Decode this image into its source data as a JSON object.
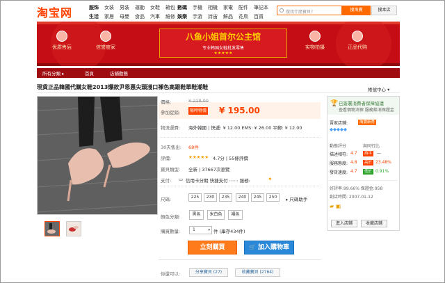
{
  "topbar": {
    "logo": "淘宝网",
    "nav1_row1": [
      "服饰",
      "女装",
      "男装",
      "運動",
      "女鞋",
      "箱包"
    ],
    "nav1_row2": [
      "生活",
      "家居",
      "母嬰",
      "食品",
      "汽車",
      "維修"
    ],
    "nav2_row1": [
      "數碼",
      "手機",
      "相機",
      "家電",
      "配件",
      "筆記本"
    ],
    "nav2_row2": [
      "娛樂",
      "手游",
      "詩宙",
      "鮮品",
      "花鳥",
      "百貨"
    ],
    "search_placeholder": "搜找什麼寶貝?",
    "search_button": "搜淘寶",
    "shop_button": "搜本店"
  },
  "banner": {
    "title": "八鱼小姐首尔公主馆",
    "subtitle": "专业韩国女鞋批发零售",
    "stars": "★★★★★",
    "left_icons": [
      "优质售后",
      "信誉度家"
    ],
    "right_icons": [
      "实物拍摄",
      "正品代购"
    ]
  },
  "shopnav": {
    "all_categories": "所有分類 ▸",
    "home": "首頁",
    "shop_dynamics": "店鋪動態"
  },
  "product": {
    "title": "現貨正品韓國代購女鞋2013爆款尹恩惠尖頭淺口裸色高跟鞋單鞋潮鞋",
    "fav_link": "帳號中心 ▾",
    "price_label": "價格:",
    "orig_price": "¥ 218.00",
    "promo_label": "參加促銷:",
    "promo_badge": "限時特價",
    "promo_price": "¥ 195.00",
    "shipping_label": "物流運費:",
    "shipping_value": "海外韓國 | 快遞: ¥ 12.00  EMS: ¥ 26.00  平郵: ¥ 12.00",
    "sales_label": "30天售出:",
    "sales_value": "68件",
    "rating_label": "評價:",
    "rating_stars": "★★★★★",
    "rating_value": "4.7分 | 55條評價",
    "guarantee_label": "寶貝類型:",
    "guarantee_value": "全新 | 37667次瀏覽",
    "pay_label": "支付:",
    "pay_value": "信用卡分期  快捷支付  ⋯⋯  服務:",
    "size_label": "尺碼:",
    "sizes": [
      "225",
      "230",
      "235",
      "240",
      "245",
      "250"
    ],
    "size_helper": "▸ 尺碼助手",
    "color_label": "顏色分類:",
    "colors": [
      "黑色",
      "米白色",
      "裸色"
    ],
    "qty_label": "購買數量:",
    "qty_value": "1",
    "stock": "件 (庫存434件)",
    "buy_button": "立刻購買",
    "cart_button": "加入購物車",
    "share_label": "你還可以:",
    "share_button": "分享寶貝 (27)",
    "collect_button": "收藏寶貝 (2764)"
  },
  "seller": {
    "badge_line1": "已簽署消費者保障協議",
    "badge_line2": "查看價物消保 服務條消保證金",
    "seller_label": "賣家店鋪:",
    "seller_tag": "淘寶新秀",
    "dsr_title": "動態評分",
    "dsr_compare": "與同行比",
    "dsr": [
      {
        "label": "描述相符:",
        "score": "4.7",
        "tag": "持平",
        "pct": "—"
      },
      {
        "label": "服務態度:",
        "score": "4.8",
        "tag": "高於",
        "pct": "23.48%"
      },
      {
        "label": "發貨速度:",
        "score": "4.7",
        "tag": "低於",
        "pct": "0.91%"
      }
    ],
    "good_rate": "好評率:99.66%  保證金:958",
    "since": "創店時間: 2007-01-12",
    "enter_shop": "進入店鋪",
    "collect_shop": "收藏店鋪"
  },
  "colors": {
    "brand": "#ff4400",
    "banner_red": "#c40d14",
    "nav_red": "#a00d10",
    "buy_orange": "#ff7a1a",
    "cart_blue": "#2a88d8"
  }
}
